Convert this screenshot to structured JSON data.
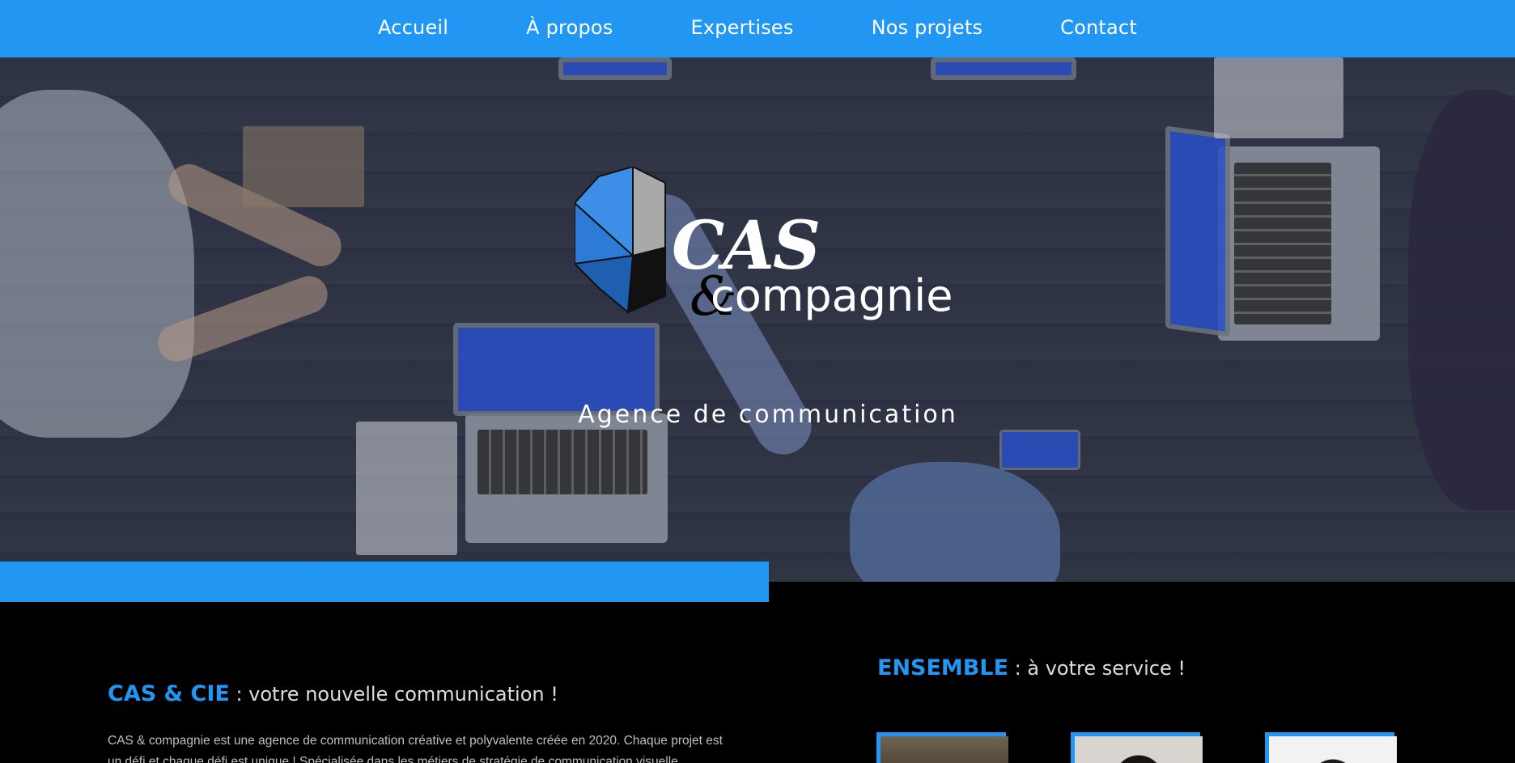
{
  "nav": {
    "items": [
      {
        "label": "Accueil"
      },
      {
        "label": "À propos"
      },
      {
        "label": "Expertises"
      },
      {
        "label": "Nos projets"
      },
      {
        "label": "Contact"
      }
    ]
  },
  "hero": {
    "logo": {
      "cas": "CAS",
      "amp": "&",
      "compagnie": "compagnie"
    },
    "tagline": "Agence de communication"
  },
  "about": {
    "title_accent": "CAS & CIE",
    "title_rest": " : votre nouvelle communication !",
    "text": "CAS & compagnie est une agence de communication créative et polyvalente créée en 2020. Chaque projet est un défi et chaque défi est unique ! Spécialisée dans les métiers de stratégie de communication visuelle"
  },
  "team": {
    "title_accent": "ENSEMBLE",
    "title_rest": " : à votre service !"
  },
  "colors": {
    "accent": "#2196f3",
    "background": "#000000"
  }
}
